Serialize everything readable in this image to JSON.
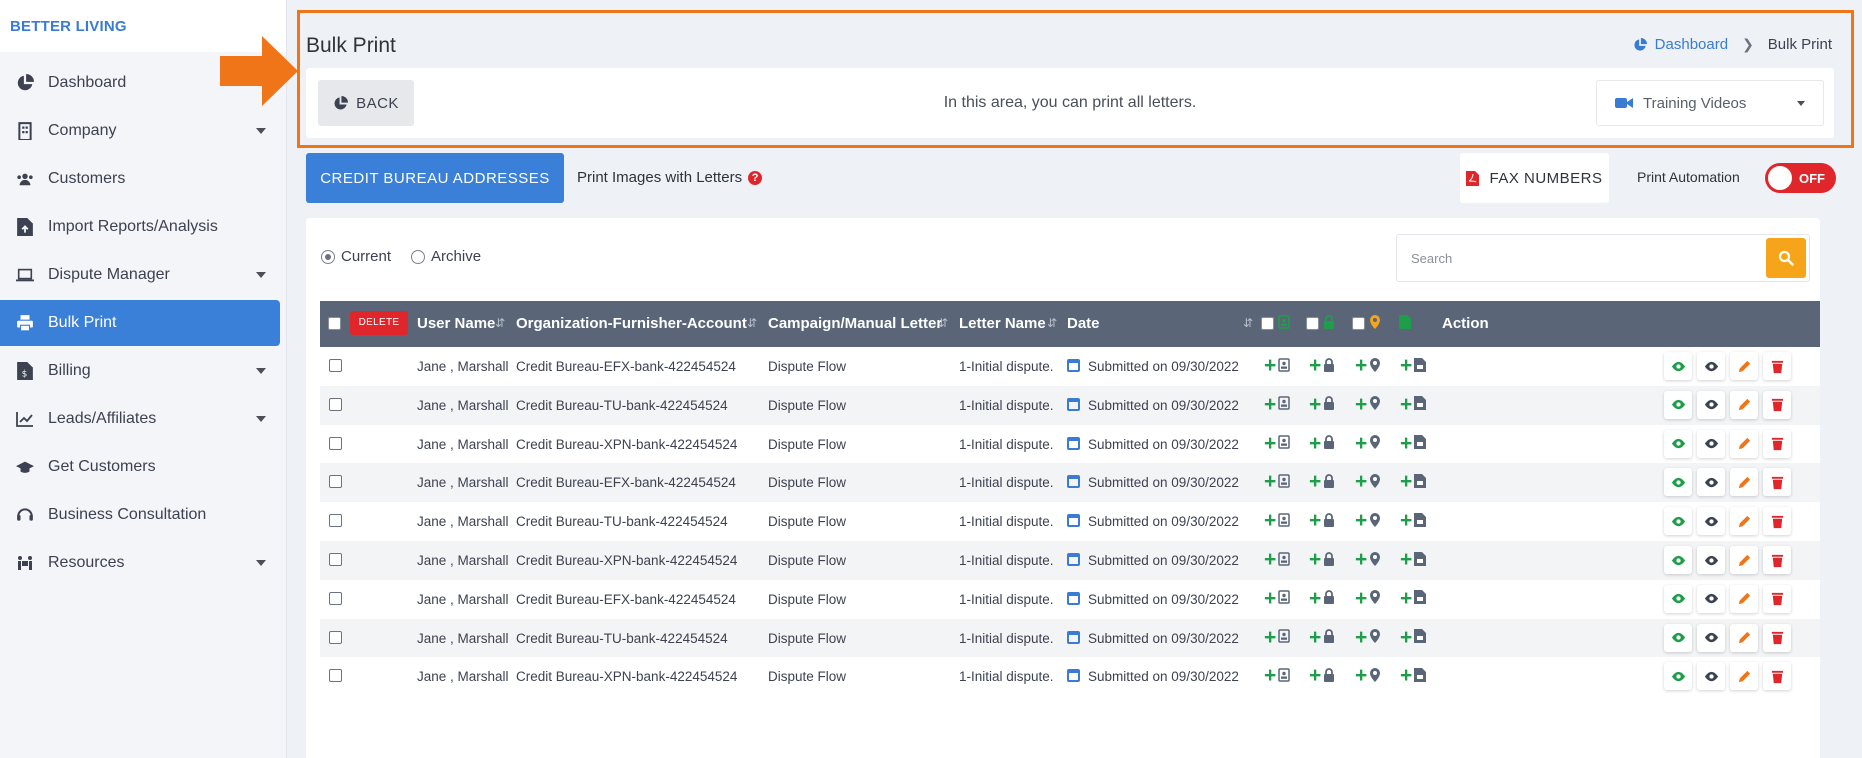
{
  "brand": "BETTER LIVING",
  "sidebar": {
    "items": [
      {
        "label": "Dashboard",
        "icon": "pie-chart-icon",
        "caret": false,
        "active": false
      },
      {
        "label": "Company",
        "icon": "building-icon",
        "caret": true,
        "active": false
      },
      {
        "label": "Customers",
        "icon": "users-icon",
        "caret": false,
        "active": false
      },
      {
        "label": "Import Reports/Analysis",
        "icon": "file-upload-icon",
        "caret": false,
        "active": false
      },
      {
        "label": "Dispute Manager",
        "icon": "laptop-icon",
        "caret": true,
        "active": false
      },
      {
        "label": "Bulk Print",
        "icon": "printer-icon",
        "caret": false,
        "active": true
      },
      {
        "label": "Billing",
        "icon": "invoice-icon",
        "caret": true,
        "active": false
      },
      {
        "label": "Leads/Affiliates",
        "icon": "chart-line-icon",
        "caret": true,
        "active": false
      },
      {
        "label": "Get Customers",
        "icon": "graduation-cap-icon",
        "caret": false,
        "active": false
      },
      {
        "label": "Business Consultation",
        "icon": "headset-icon",
        "caret": false,
        "active": false
      },
      {
        "label": "Resources",
        "icon": "people-carry-icon",
        "caret": true,
        "active": false
      }
    ]
  },
  "header": {
    "title": "Bulk Print",
    "breadcrumb": {
      "home": "Dashboard",
      "current": "Bulk Print"
    },
    "back_label": "BACK",
    "info_text": "In this area, you can print all letters.",
    "videos_label": "Training Videos"
  },
  "toolbar": {
    "credit_bureau_label": "CREDIT BUREAU ADDRESSES",
    "print_images_label": "Print Images with Letters",
    "help_glyph": "?",
    "fax_label": "FAX NUMBERS",
    "automation_label": "Print Automation",
    "toggle_label": "OFF"
  },
  "filters": {
    "current": "Current",
    "archive": "Archive",
    "selected": "Current",
    "search_placeholder": "Search"
  },
  "table": {
    "delete_label": "DELETE",
    "columns": {
      "user": "User Name",
      "org": "Organization-Furnisher-Account",
      "campaign": "Campaign/Manual Letter",
      "letter": "Letter Name",
      "date": "Date",
      "action": "Action"
    },
    "rows": [
      {
        "user": "Jane , Marshall",
        "org": "Credit Bureau-EFX-bank-422454524",
        "campaign": "Dispute Flow",
        "letter": "1-Initial dispute.",
        "date": "Submitted on 09/30/2022"
      },
      {
        "user": "Jane , Marshall",
        "org": "Credit Bureau-TU-bank-422454524",
        "campaign": "Dispute Flow",
        "letter": "1-Initial dispute.",
        "date": "Submitted on 09/30/2022"
      },
      {
        "user": "Jane , Marshall",
        "org": "Credit Bureau-XPN-bank-422454524",
        "campaign": "Dispute Flow",
        "letter": "1-Initial dispute.",
        "date": "Submitted on 09/30/2022"
      },
      {
        "user": "Jane , Marshall",
        "org": "Credit Bureau-EFX-bank-422454524",
        "campaign": "Dispute Flow",
        "letter": "1-Initial dispute.",
        "date": "Submitted on 09/30/2022"
      },
      {
        "user": "Jane , Marshall",
        "org": "Credit Bureau-TU-bank-422454524",
        "campaign": "Dispute Flow",
        "letter": "1-Initial dispute.",
        "date": "Submitted on 09/30/2022"
      },
      {
        "user": "Jane , Marshall",
        "org": "Credit Bureau-XPN-bank-422454524",
        "campaign": "Dispute Flow",
        "letter": "1-Initial dispute.",
        "date": "Submitted on 09/30/2022"
      },
      {
        "user": "Jane , Marshall",
        "org": "Credit Bureau-EFX-bank-422454524",
        "campaign": "Dispute Flow",
        "letter": "1-Initial dispute.",
        "date": "Submitted on 09/30/2022"
      },
      {
        "user": "Jane , Marshall",
        "org": "Credit Bureau-TU-bank-422454524",
        "campaign": "Dispute Flow",
        "letter": "1-Initial dispute.",
        "date": "Submitted on 09/30/2022"
      },
      {
        "user": "Jane , Marshall",
        "org": "Credit Bureau-XPN-bank-422454524",
        "campaign": "Dispute Flow",
        "letter": "1-Initial dispute.",
        "date": "Submitted on 09/30/2022"
      }
    ]
  },
  "colors": {
    "primary": "#3a7fd8",
    "highlight": "#f07518",
    "danger": "#e0262b",
    "success": "#1e9e4a",
    "search_button": "#f6a41a",
    "table_header": "#5a6678"
  }
}
